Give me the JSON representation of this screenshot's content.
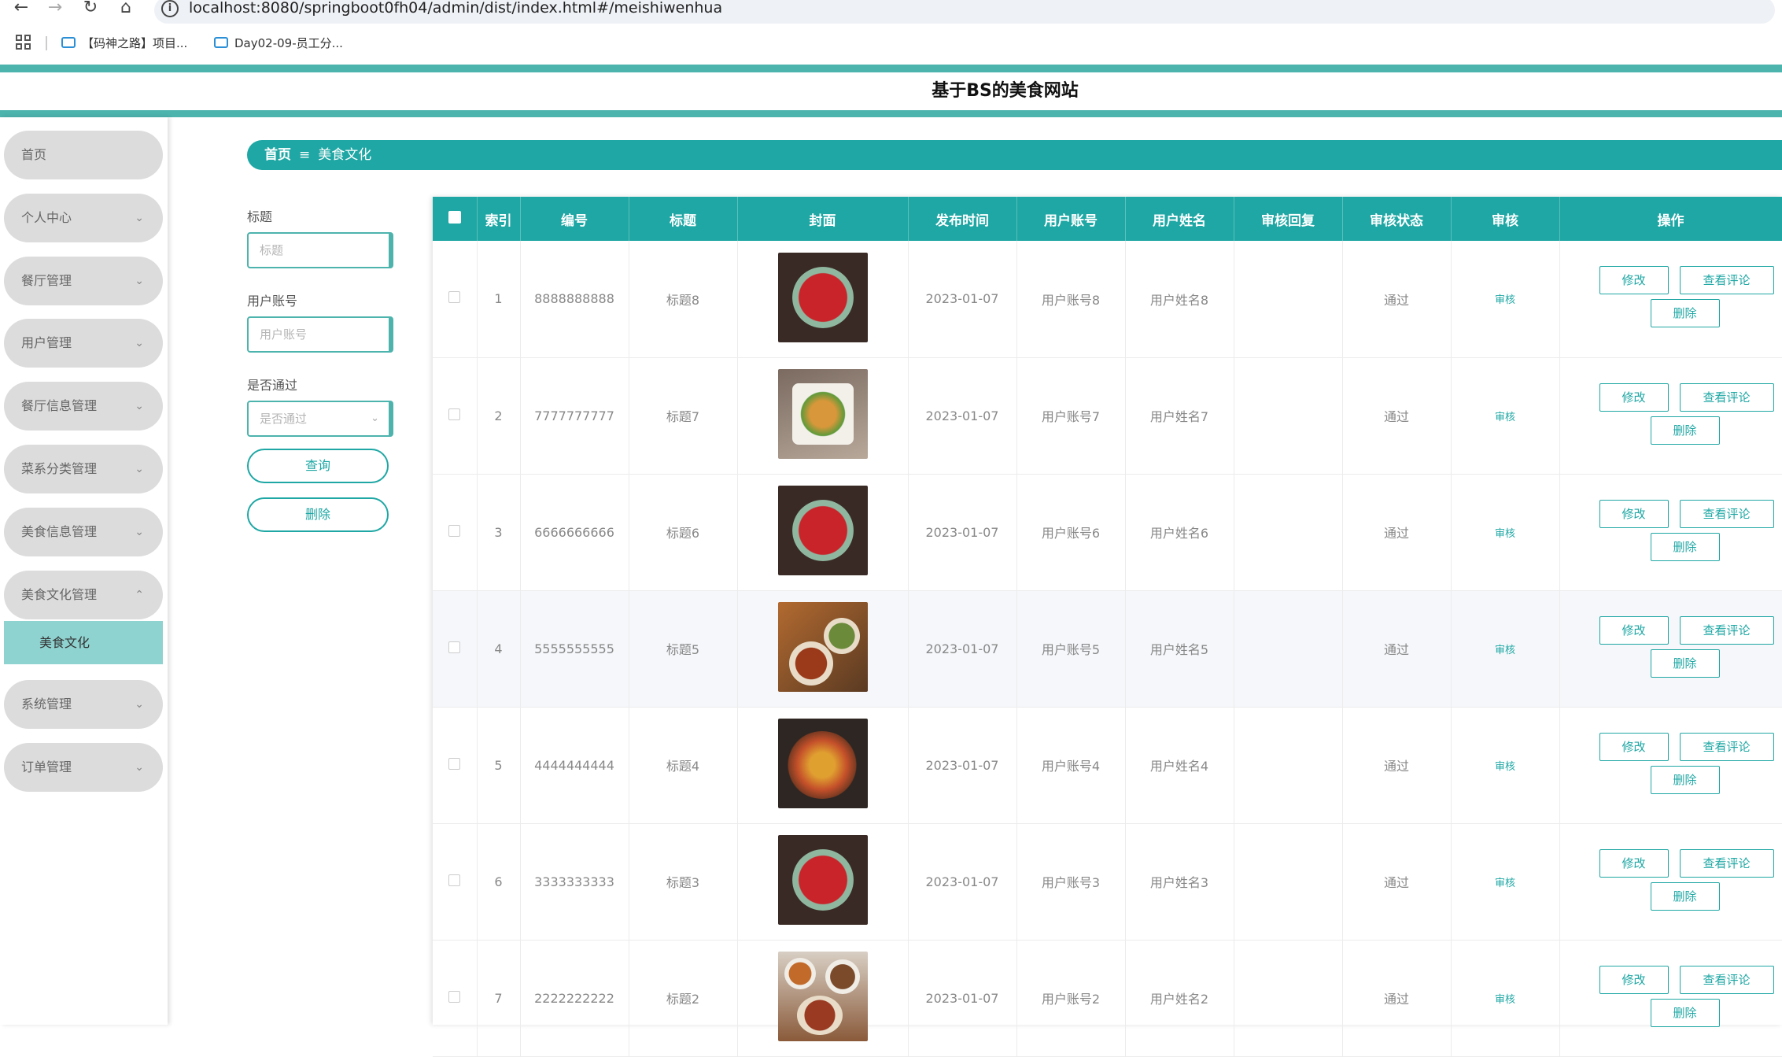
{
  "browser": {
    "url": "localhost:8080/springboot0fh04/admin/dist/index.html#/meishiwenhua",
    "bookmarks": [
      "【码神之路】项目...",
      "Day02-09-员工分..."
    ]
  },
  "app": {
    "title": "基于BS的美食网站"
  },
  "sidebar": {
    "items": [
      {
        "label": "首页"
      },
      {
        "label": "个人中心"
      },
      {
        "label": "餐厅管理"
      },
      {
        "label": "用户管理"
      },
      {
        "label": "餐厅信息管理"
      },
      {
        "label": "菜系分类管理"
      },
      {
        "label": "美食信息管理"
      },
      {
        "label": "美食文化管理"
      },
      {
        "label": "系统管理"
      },
      {
        "label": "订单管理"
      }
    ],
    "active_sub": "美食文化"
  },
  "breadcrumb": {
    "home": "首页",
    "current": "美食文化"
  },
  "filters": {
    "title_label": "标题",
    "title_placeholder": "标题",
    "account_label": "用户账号",
    "account_placeholder": "用户账号",
    "pass_label": "是否通过",
    "pass_placeholder": "是否通过",
    "query_button": "查询",
    "delete_button": "删除"
  },
  "table": {
    "headers": [
      "索引",
      "编号",
      "标题",
      "封面",
      "发布时间",
      "用户账号",
      "用户姓名",
      "审核回复",
      "审核状态",
      "审核",
      "操作"
    ],
    "actions": {
      "edit": "修改",
      "comments": "查看评论",
      "delete": "删除"
    },
    "rows": [
      {
        "index": "1",
        "code": "8888888888",
        "title": "标题8",
        "date": "2023-01-07",
        "account": "用户账号8",
        "name": "用户姓名8",
        "reply": "",
        "status": "通过",
        "audit": "审核"
      },
      {
        "index": "2",
        "code": "7777777777",
        "title": "标题7",
        "date": "2023-01-07",
        "account": "用户账号7",
        "name": "用户姓名7",
        "reply": "",
        "status": "通过",
        "audit": "审核"
      },
      {
        "index": "3",
        "code": "6666666666",
        "title": "标题6",
        "date": "2023-01-07",
        "account": "用户账号6",
        "name": "用户姓名6",
        "reply": "",
        "status": "通过",
        "audit": "审核"
      },
      {
        "index": "4",
        "code": "5555555555",
        "title": "标题5",
        "date": "2023-01-07",
        "account": "用户账号5",
        "name": "用户姓名5",
        "reply": "",
        "status": "通过",
        "audit": "审核"
      },
      {
        "index": "5",
        "code": "4444444444",
        "title": "标题4",
        "date": "2023-01-07",
        "account": "用户账号4",
        "name": "用户姓名4",
        "reply": "",
        "status": "通过",
        "audit": "审核"
      },
      {
        "index": "6",
        "code": "3333333333",
        "title": "标题3",
        "date": "2023-01-07",
        "account": "用户账号3",
        "name": "用户姓名3",
        "reply": "",
        "status": "通过",
        "audit": "审核"
      },
      {
        "index": "7",
        "code": "2222222222",
        "title": "标题2",
        "date": "2023-01-07",
        "account": "用户账号2",
        "name": "用户姓名2",
        "reply": "",
        "status": "通过",
        "audit": "审核"
      }
    ]
  }
}
